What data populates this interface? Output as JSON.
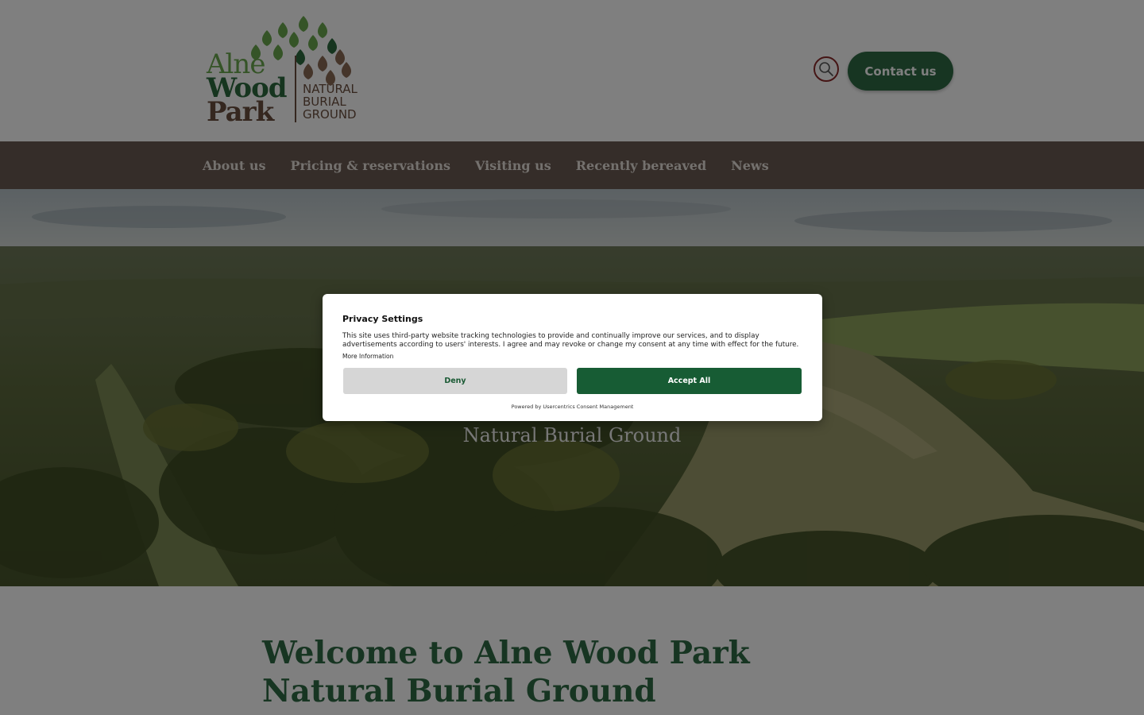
{
  "header": {
    "logo": {
      "line1": "Alne",
      "line2": "Wood",
      "line3": "Park",
      "sub1": "NATURAL",
      "sub2": "BURIAL",
      "sub3": "GROUND"
    },
    "search_icon": "search-icon",
    "contact_label": "Contact us"
  },
  "nav": {
    "items": [
      {
        "label": "About us"
      },
      {
        "label": "Pricing & reservations"
      },
      {
        "label": "Visiting us"
      },
      {
        "label": "Recently bereaved"
      },
      {
        "label": "News"
      }
    ]
  },
  "hero": {
    "subtitle": "Natural Burial Ground"
  },
  "main": {
    "heading": "Welcome to Alne Wood Park Natural Burial Ground"
  },
  "consent": {
    "title": "Privacy Settings",
    "body": "This site uses third-party website tracking technologies to provide and continually improve our services, and to display advertisements according to users' interests. I agree and may revoke or change my consent at any time with effect for the future.",
    "more_info": "More Information",
    "deny_label": "Deny",
    "accept_label": "Accept All",
    "powered_by": "Powered by Usercentrics Consent Management"
  },
  "colors": {
    "brand_green": "#2f6b45",
    "nav_brown": "#6b5a52",
    "accept_green": "#175c34",
    "search_ring": "#8b2a2a"
  }
}
